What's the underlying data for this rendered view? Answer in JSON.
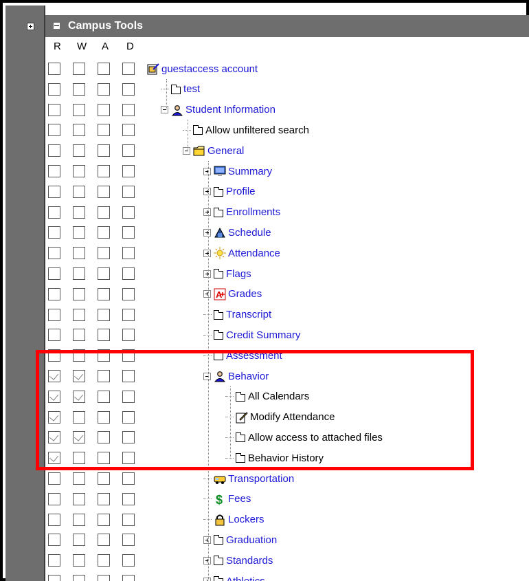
{
  "header": {
    "title": "Campus Tools"
  },
  "columns": [
    "R",
    "W",
    "A",
    "D"
  ],
  "rows": [
    {
      "label": "guestaccess account",
      "link": true,
      "icon": "account-icon",
      "depth": 0,
      "toggle": "none",
      "checks": [
        false,
        false,
        false,
        false
      ]
    },
    {
      "label": "test",
      "link": true,
      "icon": "page-icon",
      "depth": 1,
      "toggle": "none",
      "checks": [
        false,
        false,
        false,
        false
      ]
    },
    {
      "label": "Student Information",
      "link": true,
      "icon": "student-icon",
      "depth": 1,
      "toggle": "minus",
      "checks": [
        false,
        false,
        false,
        false
      ]
    },
    {
      "label": "Allow unfiltered search",
      "link": false,
      "icon": "page-icon",
      "depth": 2,
      "toggle": "none",
      "checks": [
        false,
        false,
        false,
        false
      ]
    },
    {
      "label": "General",
      "link": true,
      "icon": "folder-icon",
      "depth": 2,
      "toggle": "minus",
      "checks": [
        false,
        false,
        false,
        false
      ]
    },
    {
      "label": "Summary",
      "link": true,
      "icon": "monitor-icon",
      "depth": 3,
      "toggle": "plus",
      "checks": [
        false,
        false,
        false,
        false
      ]
    },
    {
      "label": "Profile",
      "link": true,
      "icon": "page-icon",
      "depth": 3,
      "toggle": "plus",
      "checks": [
        false,
        false,
        false,
        false
      ]
    },
    {
      "label": "Enrollments",
      "link": true,
      "icon": "page-icon",
      "depth": 3,
      "toggle": "plus",
      "checks": [
        false,
        false,
        false,
        false
      ]
    },
    {
      "label": "Schedule",
      "link": true,
      "icon": "schedule-icon",
      "depth": 3,
      "toggle": "plus",
      "checks": [
        false,
        false,
        false,
        false
      ]
    },
    {
      "label": "Attendance",
      "link": true,
      "icon": "attendance-icon",
      "depth": 3,
      "toggle": "plus",
      "checks": [
        false,
        false,
        false,
        false
      ]
    },
    {
      "label": "Flags",
      "link": true,
      "icon": "page-icon",
      "depth": 3,
      "toggle": "plus",
      "checks": [
        false,
        false,
        false,
        false
      ]
    },
    {
      "label": "Grades",
      "link": true,
      "icon": "grades-icon",
      "depth": 3,
      "toggle": "plus",
      "checks": [
        false,
        false,
        false,
        false
      ]
    },
    {
      "label": "Transcript",
      "link": true,
      "icon": "page-icon",
      "depth": 3,
      "toggle": "none",
      "checks": [
        false,
        false,
        false,
        false
      ]
    },
    {
      "label": "Credit Summary",
      "link": true,
      "icon": "page-icon",
      "depth": 3,
      "toggle": "none",
      "checks": [
        false,
        false,
        false,
        false
      ]
    },
    {
      "label": "Assessment",
      "link": true,
      "icon": "page-icon",
      "depth": 3,
      "toggle": "none",
      "checks": [
        false,
        false,
        false,
        false
      ]
    },
    {
      "label": "Behavior",
      "link": true,
      "icon": "behavior-icon",
      "depth": 3,
      "toggle": "minus",
      "checks": [
        true,
        true,
        false,
        false
      ]
    },
    {
      "label": "All Calendars",
      "link": false,
      "icon": "page-icon",
      "depth": 4,
      "toggle": "none",
      "checks": [
        true,
        true,
        false,
        false
      ]
    },
    {
      "label": "Modify Attendance",
      "link": false,
      "icon": "edit-icon",
      "depth": 4,
      "toggle": "none",
      "checks": [
        true,
        false,
        false,
        false
      ]
    },
    {
      "label": "Allow access to attached files",
      "link": false,
      "icon": "page-icon",
      "depth": 4,
      "toggle": "none",
      "checks": [
        true,
        true,
        false,
        false
      ]
    },
    {
      "label": "Behavior History",
      "link": false,
      "icon": "page-icon",
      "depth": 4,
      "toggle": "none",
      "checks": [
        true,
        false,
        false,
        false
      ]
    },
    {
      "label": "Transportation",
      "link": true,
      "icon": "bus-icon",
      "depth": 3,
      "toggle": "none",
      "checks": [
        false,
        false,
        false,
        false
      ]
    },
    {
      "label": "Fees",
      "link": true,
      "icon": "dollar-icon",
      "depth": 3,
      "toggle": "none",
      "checks": [
        false,
        false,
        false,
        false
      ]
    },
    {
      "label": "Lockers",
      "link": true,
      "icon": "lock-icon",
      "depth": 3,
      "toggle": "none",
      "checks": [
        false,
        false,
        false,
        false
      ]
    },
    {
      "label": "Graduation",
      "link": true,
      "icon": "page-icon",
      "depth": 3,
      "toggle": "plus",
      "checks": [
        false,
        false,
        false,
        false
      ]
    },
    {
      "label": "Standards",
      "link": true,
      "icon": "page-icon",
      "depth": 3,
      "toggle": "plus",
      "checks": [
        false,
        false,
        false,
        false
      ]
    },
    {
      "label": "Athletics",
      "link": true,
      "icon": "page-icon",
      "depth": 3,
      "toggle": "plus",
      "checks": [
        false,
        false,
        false,
        false
      ]
    }
  ],
  "colors": {
    "link": "#1c17d6",
    "highlight_border": "#ff0000",
    "header_bg": "#6e6e6e"
  }
}
